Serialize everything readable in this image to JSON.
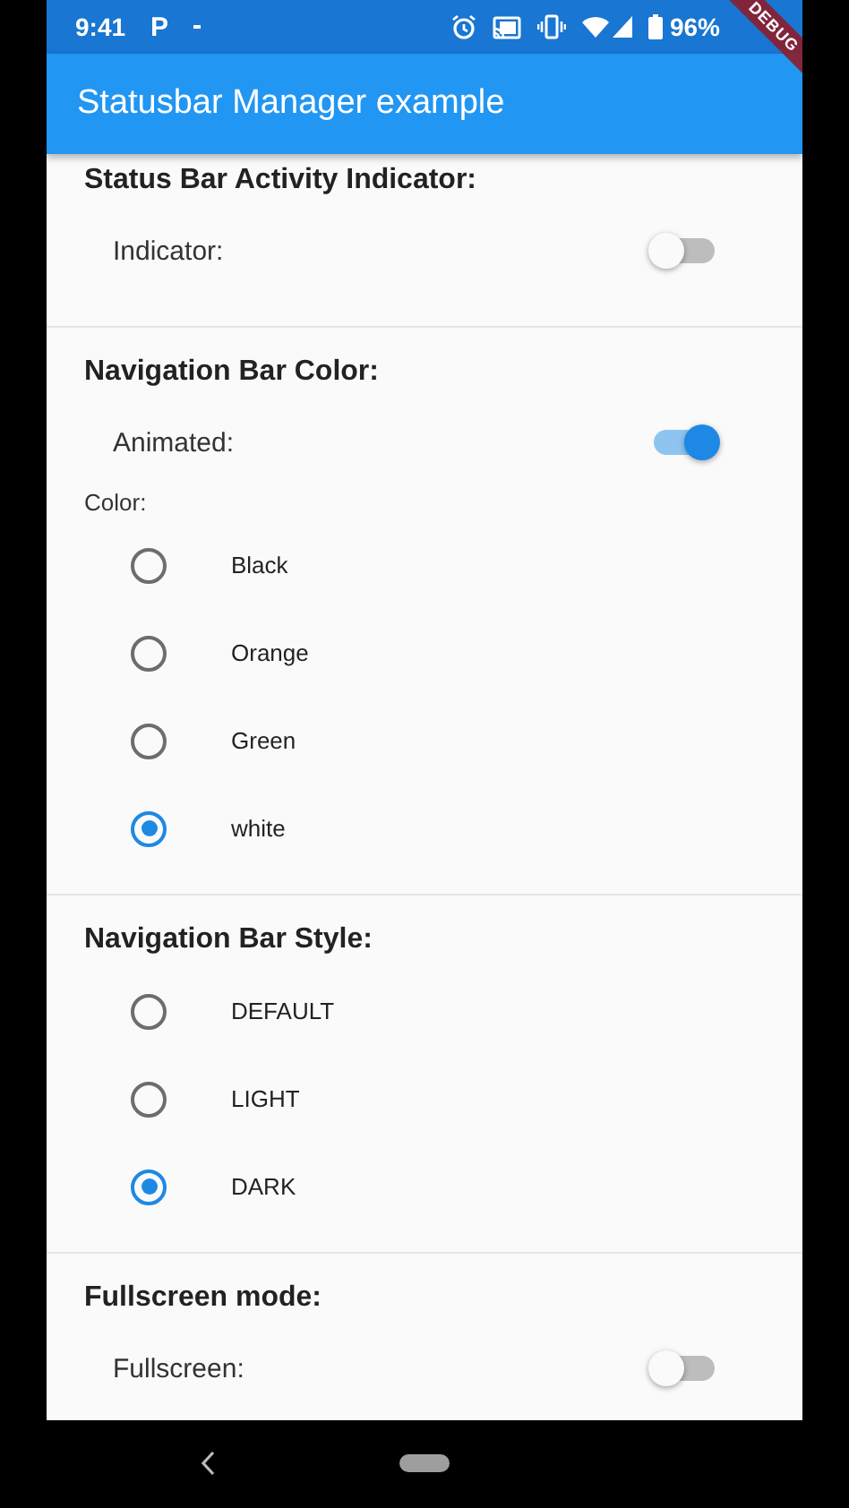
{
  "status_bar": {
    "time": "9:41",
    "notification_glyph": "P",
    "battery": "96%"
  },
  "debug_banner": "DEBUG",
  "app_bar": {
    "title": "Statusbar Manager example"
  },
  "sections": [
    {
      "title": "Status Bar Activity Indicator:",
      "items": [
        {
          "kind": "switch",
          "label": "Indicator:",
          "on": false
        }
      ]
    },
    {
      "title": "Navigation Bar Color:",
      "items": [
        {
          "kind": "switch",
          "label": "Animated:",
          "on": true
        },
        {
          "kind": "caption",
          "label": "Color:"
        },
        {
          "kind": "radio",
          "label": "Black",
          "selected": false
        },
        {
          "kind": "radio",
          "label": "Orange",
          "selected": false
        },
        {
          "kind": "radio",
          "label": "Green",
          "selected": false
        },
        {
          "kind": "radio",
          "label": "white",
          "selected": true
        }
      ]
    },
    {
      "title": "Navigation Bar Style:",
      "items": [
        {
          "kind": "radio",
          "label": "DEFAULT",
          "selected": false
        },
        {
          "kind": "radio",
          "label": "LIGHT",
          "selected": false
        },
        {
          "kind": "radio",
          "label": "DARK",
          "selected": true
        }
      ]
    },
    {
      "title": "Fullscreen mode:",
      "items": [
        {
          "kind": "switch",
          "label": "Fullscreen:",
          "on": false
        }
      ]
    }
  ]
}
